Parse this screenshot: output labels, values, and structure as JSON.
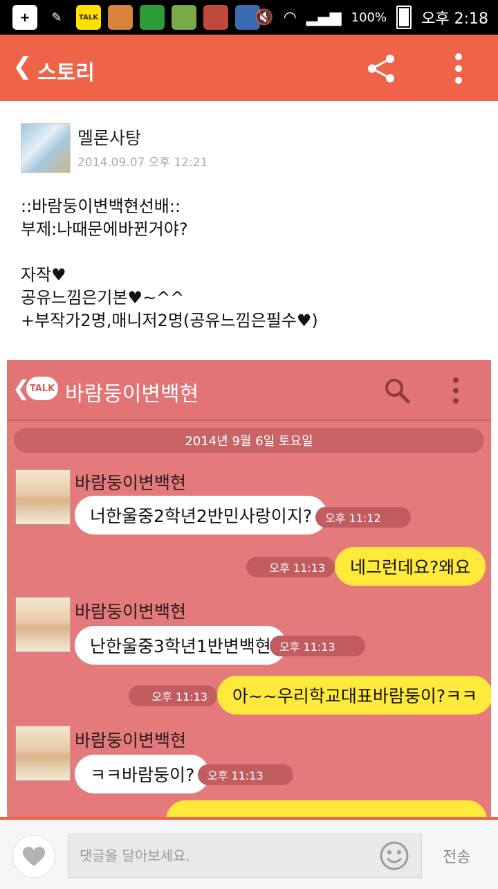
{
  "status_bar": {
    "battery": "100%",
    "time": "오후 2:18",
    "notification_icons": [
      "plus-icon",
      "broom-icon",
      "talk-icon",
      "cookie-game-icon",
      "battery-app-icon",
      "game-icon-1",
      "game-icon-2",
      "game-icon-3"
    ]
  },
  "app_bar": {
    "back_icon": "chevron-left-icon",
    "title": "스토리",
    "share_icon": "share-icon",
    "more_icon": "more-vertical-icon"
  },
  "post": {
    "author": "멜론사탕",
    "date": "2014.09.07 오후 12:21",
    "body": "::바람둥이변백현선배::\n부제:나때문에바뀐거야?\n\n자작♥\n공유느낌은기본♥~^^\n+부작가2명,매니저2명(공유느낌은필수♥)"
  },
  "chat_image": {
    "talk_badge": "TALK",
    "title": "바람둥이변백현",
    "date_divider": "2014년 9월 6일 토요일",
    "messages": [
      {
        "sender": "바람둥이변백현",
        "text": "너한울중2학년2반민사랑이지?",
        "time": "오후 11:12",
        "direction": "in"
      },
      {
        "text": "네그런데요?왜요",
        "time": "오후 11:13",
        "direction": "out"
      },
      {
        "sender": "바람둥이변백현",
        "text": "난한울중3학년1반변백현",
        "time": "오후 11:13",
        "direction": "in"
      },
      {
        "text": "아~~우리학교대표바람둥이?ㅋㅋ",
        "time": "오후 11:13",
        "direction": "out"
      },
      {
        "sender": "바람둥이변백현",
        "text": "ㅋㅋ바람둥이?",
        "time": "오후 11:13",
        "direction": "in"
      }
    ]
  },
  "comment_bar": {
    "placeholder": "댓글을 달아보세요.",
    "send_label": "전송"
  },
  "colors": {
    "app_bar": "#ef6448",
    "chat_background": "#e57a7c",
    "incoming_bubble": "#ffffff",
    "outgoing_bubble": "#ffe93a"
  }
}
